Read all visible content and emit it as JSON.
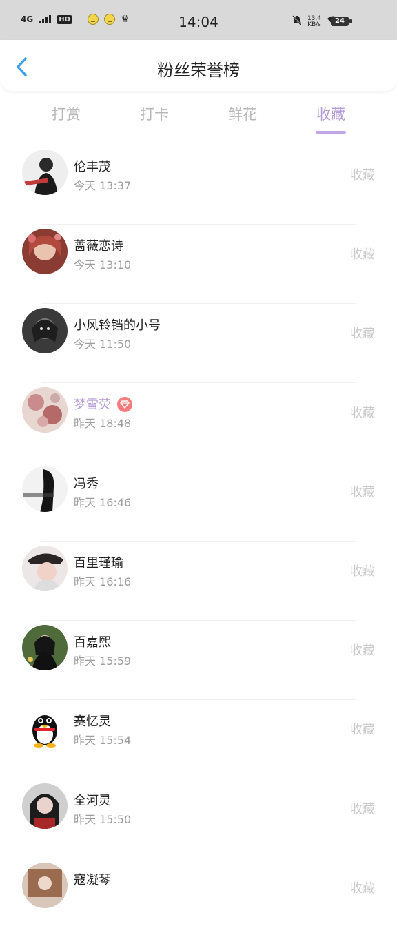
{
  "status_bar": {
    "network": "4G",
    "hd": "HD",
    "time": "14:04",
    "speed_value": "13.4",
    "speed_unit": "KB/s",
    "battery": "24"
  },
  "header": {
    "title": "粉丝荣誉榜"
  },
  "tabs": [
    {
      "label": "打赏",
      "active": false
    },
    {
      "label": "打卡",
      "active": false
    },
    {
      "label": "鲜花",
      "active": false
    },
    {
      "label": "收藏",
      "active": true
    }
  ],
  "colors": {
    "accent": "#b39ad8",
    "muted": "#c9c9c9",
    "badge": "#f47b7b"
  },
  "list": [
    {
      "name": "伦丰茂",
      "time": "今天 13:37",
      "action": "收藏",
      "vip": false
    },
    {
      "name": "蔷薇恋诗",
      "time": "今天 13:10",
      "action": "收藏",
      "vip": false
    },
    {
      "name": "小风铃铛的小号",
      "time": "今天 11:50",
      "action": "收藏",
      "vip": false
    },
    {
      "name": "梦雪荧",
      "time": "昨天 18:48",
      "action": "收藏",
      "vip": true
    },
    {
      "name": "冯秀",
      "time": "昨天 16:46",
      "action": "收藏",
      "vip": false
    },
    {
      "name": "百里瑾瑜",
      "time": "昨天 16:16",
      "action": "收藏",
      "vip": false
    },
    {
      "name": "百嘉熙",
      "time": "昨天 15:59",
      "action": "收藏",
      "vip": false
    },
    {
      "name": "赛忆灵",
      "time": "昨天 15:54",
      "action": "收藏",
      "vip": false
    },
    {
      "name": "全河灵",
      "time": "昨天 15:50",
      "action": "收藏",
      "vip": false
    },
    {
      "name": "寇凝琴",
      "time": "",
      "action": "收藏",
      "vip": false
    }
  ]
}
